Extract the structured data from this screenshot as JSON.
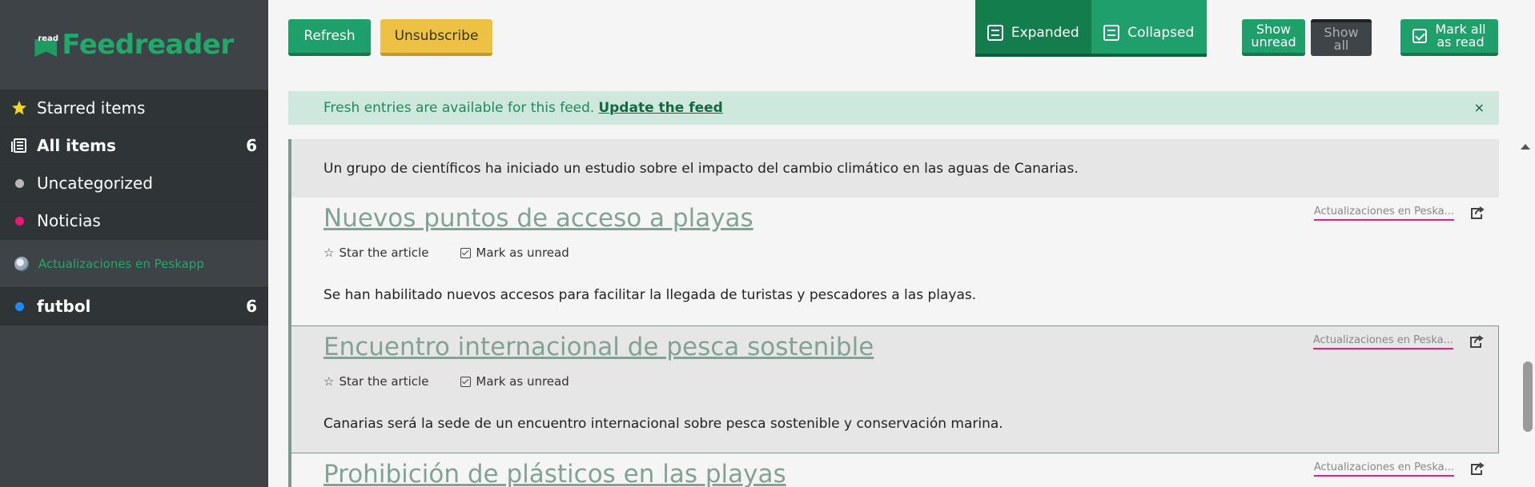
{
  "app": {
    "logo_badge": "read",
    "logo_text": "Feedreader"
  },
  "sidebar": {
    "items": [
      {
        "label": "Starred items",
        "count": "",
        "icon": "star-icon"
      },
      {
        "label": "All items",
        "count": "6",
        "icon": "list-icon"
      },
      {
        "label": "Uncategorized",
        "count": "",
        "icon": "dot-icon",
        "color": "#b8b8b8"
      },
      {
        "label": "Noticias",
        "count": "",
        "icon": "dot-icon",
        "color": "#e8177b"
      }
    ],
    "feed": {
      "label": "Actualizaciones en Peskapp",
      "icon": "globe-icon"
    },
    "folder": {
      "label": "futbol",
      "count": "6",
      "color": "#1a8cff"
    }
  },
  "toolbar": {
    "refresh": "Refresh",
    "unsubscribe": "Unsubscribe",
    "expanded": "Expanded",
    "collapsed": "Collapsed",
    "show_unread_1": "Show",
    "show_unread_2": "unread",
    "show_all_1": "Show",
    "show_all_2": "all",
    "mark_all_1": "Mark all",
    "mark_all_2": "as read"
  },
  "notice": {
    "text": "Fresh entries are available for this feed.",
    "link": "Update the feed",
    "close": "×"
  },
  "articles": {
    "top_summary": "Un grupo de científicos ha iniciado un estudio sobre el impacto del cambio climático en las aguas de Canarias.",
    "star_label": "Star the article",
    "unread_label": "Mark as unread",
    "source": "Actualizaciones en Peska...",
    "items": [
      {
        "title": "Nuevos puntos de acceso a playas",
        "body": "Se han habilitado nuevos accesos para facilitar la llegada de turistas y pescadores a las playas."
      },
      {
        "title": "Encuentro internacional de pesca sostenible",
        "body": "Canarias será la sede de un encuentro internacional sobre pesca sostenible y conservación marina."
      },
      {
        "title": "Prohibición de plásticos en las playas",
        "body": ""
      }
    ]
  },
  "colors": {
    "accent": "#1fa06a",
    "warning": "#edc143",
    "sidebar": "#3d4346",
    "link": "#82a394",
    "source_underline": "#e0207a"
  }
}
